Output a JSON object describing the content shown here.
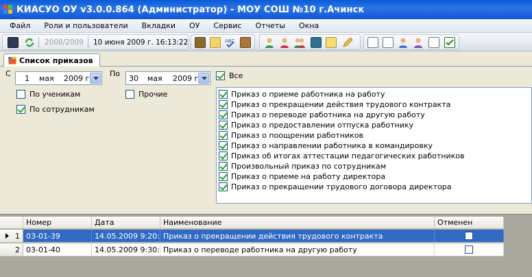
{
  "window": {
    "title": "КИАСУО ОУ v3.0.0.864 (Администратор) - МОУ СОШ №10 г.Ачинск"
  },
  "menu": {
    "items": [
      "Файл",
      "Роли и пользователи",
      "Вкладки",
      "ОУ",
      "Сервис",
      "Отчеты",
      "Окна"
    ]
  },
  "toolbar": {
    "year": "2008/2009",
    "datetime": "10 июня 2009 г. 16:13:22"
  },
  "tab": {
    "label": "Список приказов"
  },
  "filter": {
    "from_label": "С",
    "to_label": "По",
    "from_day": "1",
    "from_month": "мая",
    "from_year": "2009 г.",
    "to_day": "30",
    "to_month": "мая",
    "to_year": "2009 г.",
    "all_label": "Все",
    "by_students_label": "По ученикам",
    "by_staff_label": "По сотрудникам",
    "other_label": "Прочие",
    "by_students_checked": false,
    "by_staff_checked": true,
    "other_checked": false,
    "all_checked": true
  },
  "order_types": [
    "Приказ о приеме работника на работу",
    "Приказ о прекращении действия трудового контракта",
    "Приказ о переводе работника на другую работу",
    "Приказ о предоставлении отпуска работнику",
    "Приказ о поощрении работников",
    "Приказ о направлении работника в командировку",
    "Приказ об итогах аттестации педагогических работников",
    "Произвольный приказ по сотрудникам",
    "Приказ о приеме на работу директора",
    "Приказ о прекращении трудового договора директора"
  ],
  "grid": {
    "columns": [
      "Номер",
      "Дата",
      "Наименование",
      "Отменен"
    ],
    "rows": [
      {
        "n": "1",
        "number": "03-01-39",
        "date": "14.05.2009 9:20:...",
        "name": "Приказ о прекращении действия трудового контракта",
        "cancelled": false
      },
      {
        "n": "2",
        "number": "03-01-40",
        "date": "14.05.2009 9:30:...",
        "name": "Приказ о переводе работника на другую работу",
        "cancelled": false
      }
    ]
  },
  "colors": {
    "titlebar": "#0a5bd9",
    "selection": "#316ac5",
    "check": "#21a121"
  },
  "icons": {
    "toolbar": [
      "save-icon",
      "refresh-icon",
      "book-icon",
      "notes-icon",
      "spellcheck-icon",
      "scroll-icon",
      "person-green-icon",
      "person-red-icon",
      "people-icon",
      "calculator-icon",
      "notepad-icon",
      "pencil-icon",
      "doc-people-icon",
      "doc-user-icon",
      "users-icon",
      "person-card-icon",
      "checklist-icon",
      "checkmark-doc-icon"
    ]
  }
}
